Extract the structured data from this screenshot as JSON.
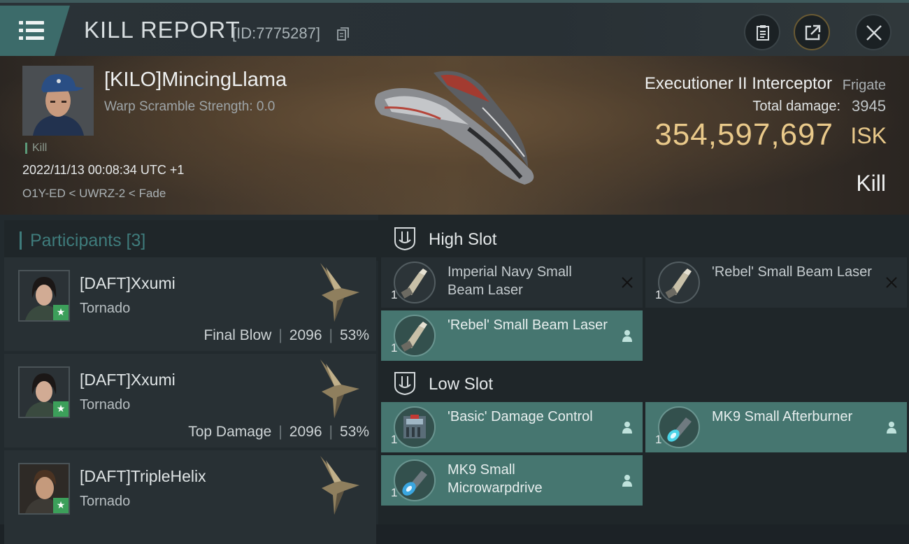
{
  "header": {
    "title": "KILL REPORT",
    "report_id": "[ID:7775287]",
    "icons": [
      "menu-icon",
      "copy-icon",
      "clipboard-icon",
      "share-icon",
      "close-icon"
    ]
  },
  "victim": {
    "name": "[KILO]MincingLlama",
    "warp_scramble": "Warp Scramble Strength: 0.0",
    "tag": "Kill",
    "time": "2022/11/13 00:08:34 UTC +1",
    "location": "O1Y-ED < UWRZ-2 < Fade",
    "ship_name": "Executioner II Interceptor",
    "ship_class": "Frigate",
    "total_damage_label": "Total damage:",
    "total_damage_value": "3945",
    "isk_value": "354,597,697",
    "isk_unit": "ISK",
    "result": "Kill"
  },
  "participants": {
    "title": "Participants [3]",
    "items": [
      {
        "name": "[DAFT]Xxumi",
        "ship": "Tornado",
        "role": "Final Blow",
        "damage": "2096",
        "percent": "53%"
      },
      {
        "name": "[DAFT]Xxumi",
        "ship": "Tornado",
        "role": "Top Damage",
        "damage": "2096",
        "percent": "53%"
      },
      {
        "name": "[DAFT]TripleHelix",
        "ship": "Tornado",
        "role": "",
        "damage": "",
        "percent": ""
      }
    ]
  },
  "fitting": {
    "high_slot": {
      "title": "High Slot",
      "modules": [
        {
          "name": "Imperial Navy Small Beam Laser",
          "qty": "1",
          "state": "destroyed"
        },
        {
          "name": "'Rebel' Small Beam Laser",
          "qty": "1",
          "state": "destroyed"
        },
        {
          "name": "'Rebel' Small Beam Laser",
          "qty": "1",
          "state": "dropped"
        }
      ]
    },
    "low_slot": {
      "title": "Low Slot",
      "modules": [
        {
          "name": "'Basic' Damage Control",
          "qty": "1",
          "state": "dropped"
        },
        {
          "name": "MK9 Small Afterburner",
          "qty": "1",
          "state": "dropped"
        },
        {
          "name": "MK9 Small Microwarpdrive",
          "qty": "1",
          "state": "dropped"
        }
      ]
    }
  },
  "colors": {
    "accent": "#3f7c7c",
    "isk": "#e9c98a",
    "active_module": "#467670"
  }
}
